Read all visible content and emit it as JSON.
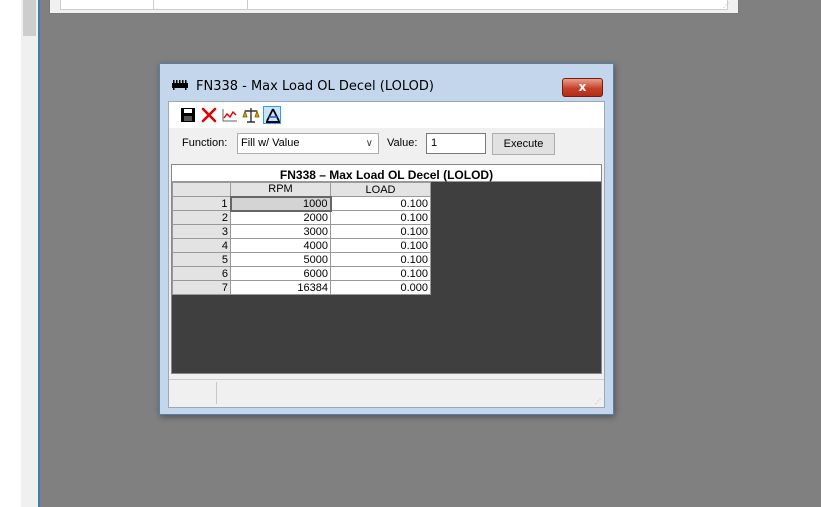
{
  "dialog": {
    "title": "FN338 - Max Load OL Decel (LOLOD)",
    "close_label": "x"
  },
  "toolbar": {
    "buttons": [
      "save-icon",
      "delete-icon",
      "graph-icon",
      "scale-icon",
      "compass-icon"
    ]
  },
  "function_bar": {
    "function_label": "Function:",
    "function_value": "Fill w/ Value",
    "value_label": "Value:",
    "value_input": "1",
    "execute_label": "Execute"
  },
  "table": {
    "title": "FN338 – Max Load OL Decel (LOLOD)",
    "columns": [
      "RPM",
      "LOAD"
    ],
    "rows": [
      {
        "index": "1",
        "rpm": "1000",
        "load": "0.100"
      },
      {
        "index": "2",
        "rpm": "2000",
        "load": "0.100"
      },
      {
        "index": "3",
        "rpm": "3000",
        "load": "0.100"
      },
      {
        "index": "4",
        "rpm": "4000",
        "load": "0.100"
      },
      {
        "index": "5",
        "rpm": "5000",
        "load": "0.100"
      },
      {
        "index": "6",
        "rpm": "6000",
        "load": "0.100"
      },
      {
        "index": "7",
        "rpm": "16384",
        "load": "0.000"
      }
    ]
  },
  "colors": {
    "workspace": "#808080",
    "grid_background": "#3f3f3f",
    "titlebar": "#c3d6ec",
    "close_button": "#c6412a"
  }
}
